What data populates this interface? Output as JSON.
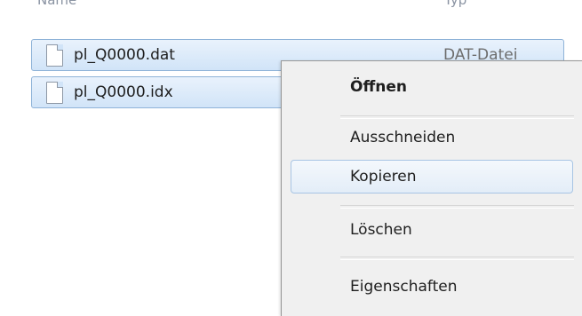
{
  "header": {
    "name_col": "Name",
    "type_col": "Typ"
  },
  "files": [
    {
      "name": "pl_Q0000.dat",
      "type": "DAT-Datei",
      "icon": "file-icon"
    },
    {
      "name": "pl_Q0000.idx",
      "type": "",
      "icon": "file-icon"
    }
  ],
  "context_menu": {
    "items": {
      "open": "Öffnen",
      "cut": "Ausschneiden",
      "copy": "Kopieren",
      "delete": "Löschen",
      "properties": "Eigenschaften"
    },
    "highlighted": "Kopieren"
  },
  "colors": {
    "selection_bg": "#d1e4f8",
    "selection_border": "#8fb3d8",
    "menu_bg": "#f0f0f0",
    "menu_hover_border": "#a8c5e4"
  }
}
